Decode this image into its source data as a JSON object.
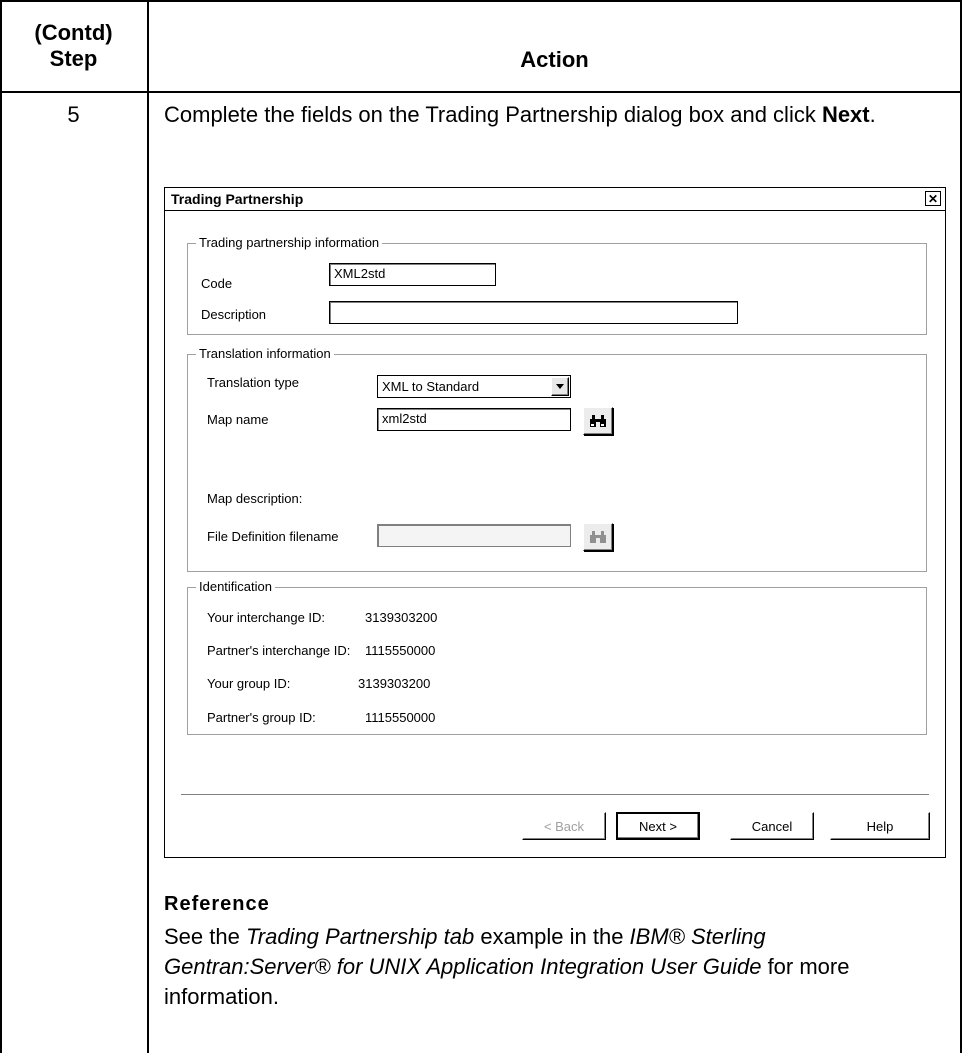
{
  "header": {
    "step_line1": "(Contd)",
    "step_line2": "Step",
    "action": "Action"
  },
  "step": {
    "number": "5",
    "instruction_text": "Complete the fields on the Trading Partnership dialog box and click ",
    "instruction_bold": "Next",
    "instruction_end": "."
  },
  "dialog": {
    "title": "Trading Partnership",
    "close_glyph": "✕",
    "tp_group": {
      "label": "Trading partnership information",
      "code_label": "Code",
      "code_value": "XML2std",
      "description_label": "Description",
      "description_value": ""
    },
    "translation_group": {
      "label": "Translation information",
      "type_label": "Translation type",
      "type_value": "XML to Standard",
      "map_name_label": "Map name",
      "map_name_value": "xml2std",
      "map_description_label": "Map description:",
      "file_def_label": "File Definition filename",
      "file_def_value": ""
    },
    "identification_group": {
      "label": "Identification",
      "your_interchange_label": "Your interchange ID:",
      "your_interchange_value": "3139303200",
      "partner_interchange_label": "Partner's interchange ID:",
      "partner_interchange_value": "1115550000",
      "your_group_label": "Your group ID:",
      "your_group_value": "3139303200",
      "partner_group_label": "Partner's group ID:",
      "partner_group_value": "1115550000"
    },
    "buttons": {
      "back": "< Back",
      "next": "Next >",
      "cancel": "Cancel",
      "help": "Help"
    },
    "icons": {
      "map_browse": "binoculars-icon",
      "file_browse": "binoculars-icon"
    }
  },
  "reference": {
    "title": "Reference",
    "p1": "See the ",
    "p2_italic": "Trading Partnership tab",
    "p3": " example in the ",
    "p4_italic": "IBM® Sterling Gentran:Server® for UNIX Application Integration User Guide",
    "p5": " for more information."
  }
}
